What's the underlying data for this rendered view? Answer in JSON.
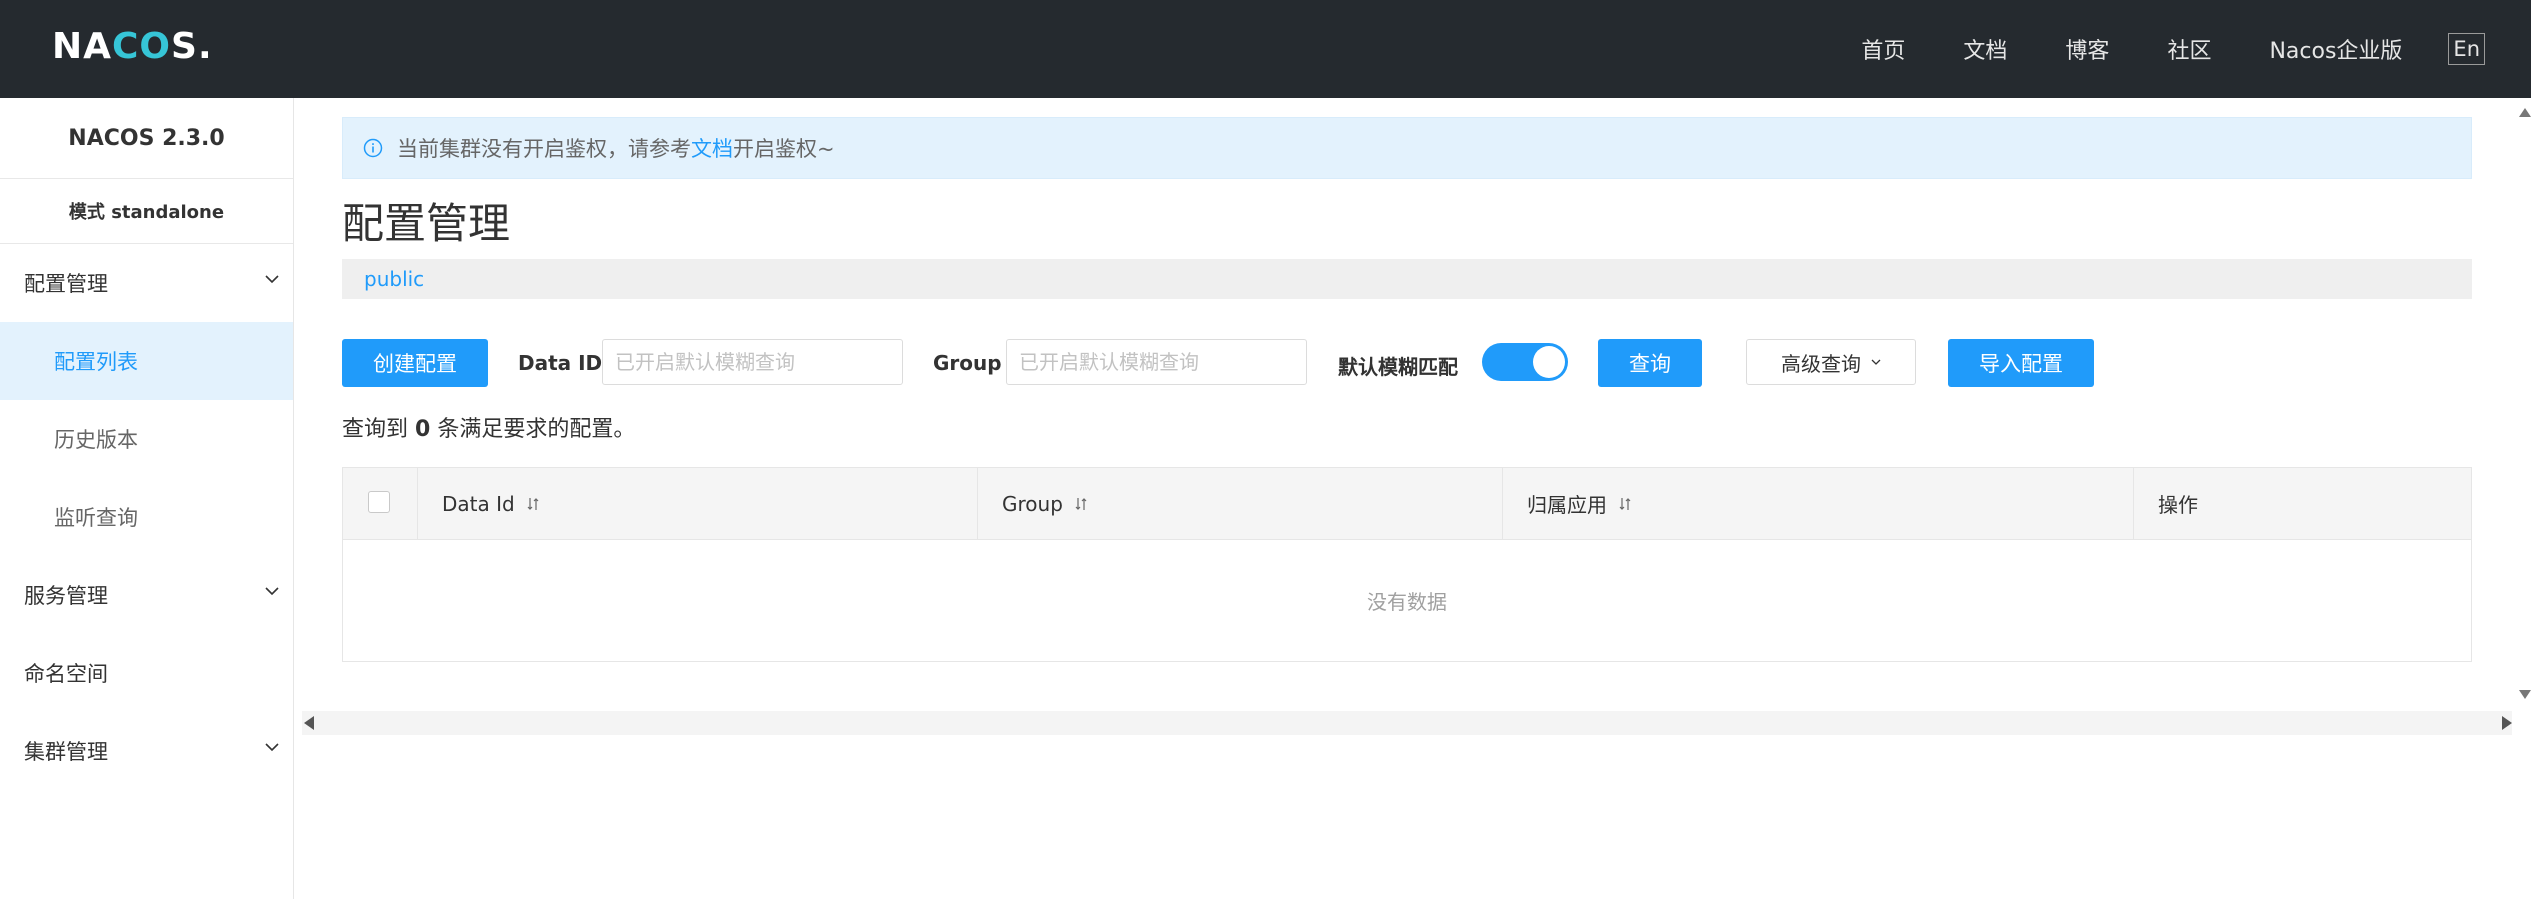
{
  "header": {
    "logo_prefix": "NA",
    "logo_accent": "CO",
    "logo_suffix": "S.",
    "nav": [
      "首页",
      "文档",
      "博客",
      "社区",
      "Nacos企业版"
    ],
    "lang": "En"
  },
  "sidebar": {
    "version": "NACOS 2.3.0",
    "mode": "模式 standalone",
    "groups": [
      {
        "label": "配置管理",
        "icon": "chevron-down-icon",
        "children": [
          "配置列表",
          "历史版本",
          "监听查询"
        ],
        "active_child": "配置列表"
      },
      {
        "label": "服务管理",
        "icon": "chevron-down-icon"
      },
      {
        "label": "命名空间"
      },
      {
        "label": "集群管理",
        "icon": "chevron-down-icon"
      }
    ]
  },
  "notice": {
    "text_before": "当前集群没有开启鉴权，请参考",
    "link": "文档",
    "text_after": "开启鉴权~",
    "icon": "info-icon"
  },
  "page": {
    "title": "配置管理",
    "namespace": "public"
  },
  "filter": {
    "create_button": "创建配置",
    "data_id_label": "Data ID",
    "data_id_placeholder": "已开启默认模糊查询",
    "data_id_value": "",
    "group_label": "Group",
    "group_placeholder": "已开启默认模糊查询",
    "group_value": "",
    "fuzzy_label": "默认模糊匹配",
    "fuzzy_on": true,
    "search_button": "查询",
    "advanced_button": "高级查询",
    "import_button": "导入配置"
  },
  "result": {
    "prefix": "查询到",
    "count": "0",
    "suffix": "条满足要求的配置。"
  },
  "table": {
    "columns": [
      "Data Id",
      "Group",
      "归属应用",
      "操作"
    ],
    "empty_text": "没有数据"
  },
  "colors": {
    "primary": "#209bfa",
    "topbar": "#252a2f",
    "notice_bg": "#e3f2fd"
  }
}
